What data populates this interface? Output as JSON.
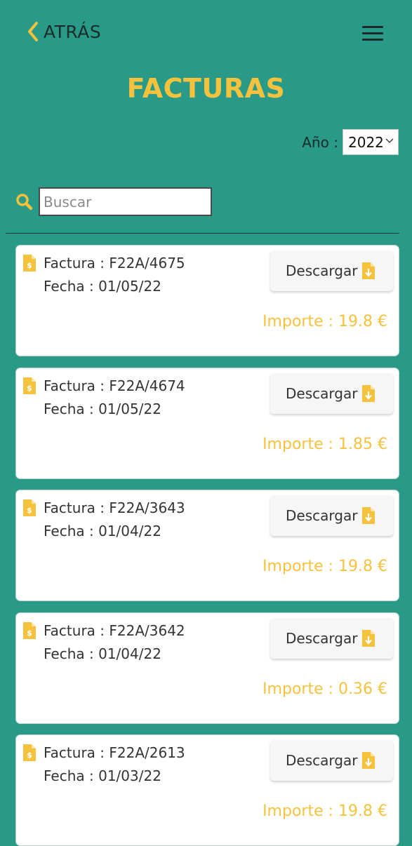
{
  "header": {
    "back_label": "ATRÁS",
    "title": "FACTURAS"
  },
  "filter": {
    "year_label": "Año :",
    "year_value": "2022"
  },
  "search": {
    "placeholder": "Buscar",
    "value": ""
  },
  "invoices": [
    {
      "invoice": "Factura : F22A/4675",
      "date": "Fecha : 01/05/22",
      "download_label": "Descargar",
      "amount": "Importe : 19.8 €"
    },
    {
      "invoice": "Factura : F22A/4674",
      "date": "Fecha : 01/05/22",
      "download_label": "Descargar",
      "amount": "Importe : 1.85 €"
    },
    {
      "invoice": "Factura : F22A/3643",
      "date": "Fecha : 01/04/22",
      "download_label": "Descargar",
      "amount": "Importe : 19.8 €"
    },
    {
      "invoice": "Factura : F22A/3642",
      "date": "Fecha : 01/04/22",
      "download_label": "Descargar",
      "amount": "Importe : 0.36 €"
    },
    {
      "invoice": "Factura : F22A/2613",
      "date": "Fecha : 01/03/22",
      "download_label": "Descargar",
      "amount": "Importe : 19.8 €"
    }
  ],
  "icons": {
    "back": "chevron-left-icon",
    "menu": "hamburger-menu-icon",
    "search": "search-icon",
    "invoice": "invoice-document-icon",
    "download": "file-download-icon",
    "select": "chevron-down-icon"
  },
  "colors": {
    "background": "#289a87",
    "accent": "#f6c23e",
    "card": "#ffffff",
    "text_dark": "#1c2a2a"
  }
}
